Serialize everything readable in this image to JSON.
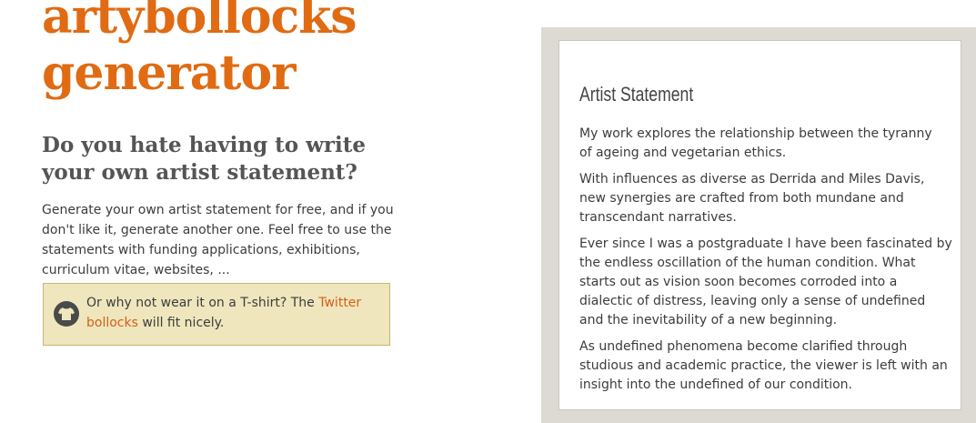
{
  "header": {
    "title_line1": "artybollocks",
    "title_line2": "generator"
  },
  "tagline": {
    "line1": "Do you hate having to write",
    "line2": "your own artist statement?"
  },
  "intro": {
    "lines": [
      "Generate your own artist statement for free, and if you",
      "don't like it, generate another one. Feel free to use the",
      "statements with funding applications, exhibitions,",
      "curriculum vitae, websites, ..."
    ]
  },
  "tshirt": {
    "icon": "t-shirt-icon",
    "text_before": "Or why not wear it on a T-shirt? The ",
    "link_part1": "Twitter",
    "link_part2": "bollocks",
    "text_after": " will fit nicely."
  },
  "statement": {
    "heading": "Artist Statement",
    "paragraphs": [
      [
        "My work explores the relationship between the tyranny",
        "of ageing and vegetarian ethics."
      ],
      [
        "With influences as diverse as Derrida and Miles Davis,",
        "new synergies are crafted from both mundane and",
        "transcendant narratives."
      ],
      [
        "Ever since I was a postgraduate I have been fascinated by",
        "the endless oscillation of the human condition. What",
        "starts out as vision soon becomes corroded into a",
        "dialectic of distress, leaving only a sense of undefined",
        "and the inevitability of a new beginning."
      ],
      [
        "As undefined phenomena become clarified through",
        "studious and academic practice, the viewer is left with an",
        "insight into the undefined of our condition."
      ]
    ]
  },
  "colors": {
    "brand_orange": "#e06b12",
    "link_orange": "#d2601a",
    "tshirt_box_bg": "#efe6bd",
    "statement_frame": "#dcdad2"
  }
}
